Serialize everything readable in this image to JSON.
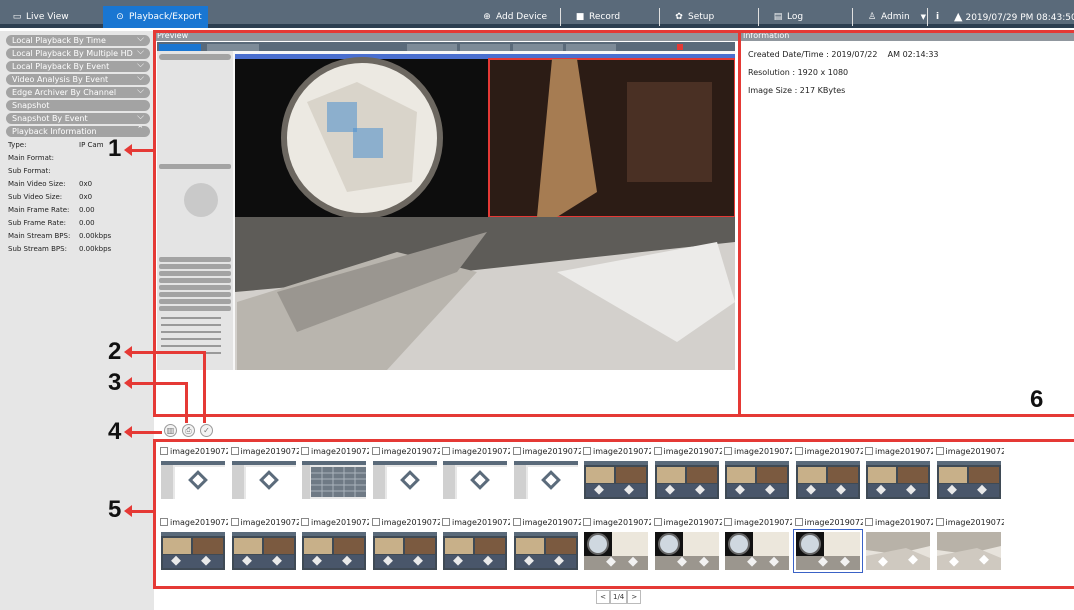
{
  "topbar": {
    "tabs": [
      {
        "label": "Live View",
        "icon": "monitor-icon",
        "active": false
      },
      {
        "label": "Playback/Export",
        "icon": "play-circle-icon",
        "active": true
      },
      {
        "label": "Add Device",
        "icon": "plus-circle-icon",
        "active": false
      },
      {
        "label": "Record",
        "icon": "record-icon",
        "active": false
      },
      {
        "label": "Setup",
        "icon": "gear-icon",
        "active": false
      },
      {
        "label": "Log",
        "icon": "document-icon",
        "active": false
      }
    ],
    "user": "Admin",
    "info_glyph": "i",
    "datetime": "2019/07/29 PM 08:43:50"
  },
  "sidebar": {
    "items": [
      "Local Playback By Time",
      "Local Playback By Multiple HD",
      "Local Playback By Event",
      "Video Analysis By Event",
      "Edge Archiver By Channel",
      "Snapshot",
      "Snapshot By Event",
      "Playback Information"
    ],
    "info": [
      {
        "label": "Type:",
        "value": "IP Cam"
      },
      {
        "label": "Main Format:",
        "value": ""
      },
      {
        "label": "Sub Format:",
        "value": ""
      },
      {
        "label": "Main Video Size:",
        "value": "0x0"
      },
      {
        "label": "Sub Video Size:",
        "value": "0x0"
      },
      {
        "label": "Main Frame Rate:",
        "value": "0.00"
      },
      {
        "label": "Sub Frame Rate:",
        "value": "0.00"
      },
      {
        "label": "Main Stream BPS:",
        "value": "0.00kbps"
      },
      {
        "label": "Sub Stream BPS:",
        "value": "0.00kbps"
      }
    ]
  },
  "preview": {
    "title": "Preview"
  },
  "information": {
    "title": "Information",
    "created": "Created Date/Time : 2019/07/22",
    "created_time": "AM 02:14:33",
    "resolution": "Resolution : 1920 x 1080",
    "image_size": "Image Size : 217 KBytes"
  },
  "toolbar": {
    "delete_icon": "trash-icon",
    "export_icon": "export-icon",
    "select_icon": "check-icon"
  },
  "callouts": [
    "1",
    "2",
    "3",
    "4",
    "5",
    "6"
  ],
  "thumbnails": {
    "caption": "image2019072",
    "row1": [
      "ui",
      "ui",
      "grid",
      "ui",
      "ui",
      "ui",
      "room",
      "room",
      "room",
      "room",
      "room",
      "room"
    ],
    "row2": [
      "room",
      "room",
      "room",
      "room",
      "room",
      "room",
      "fisheye",
      "fisheye",
      "fisheye",
      "fisheye-sel",
      "hall",
      "hall"
    ]
  },
  "pager": {
    "prev": "<",
    "page": "1/4",
    "next": ">"
  },
  "colors": {
    "accent": "#1976d2",
    "callout": "#e53935",
    "topbar": "#5a6a7a"
  }
}
